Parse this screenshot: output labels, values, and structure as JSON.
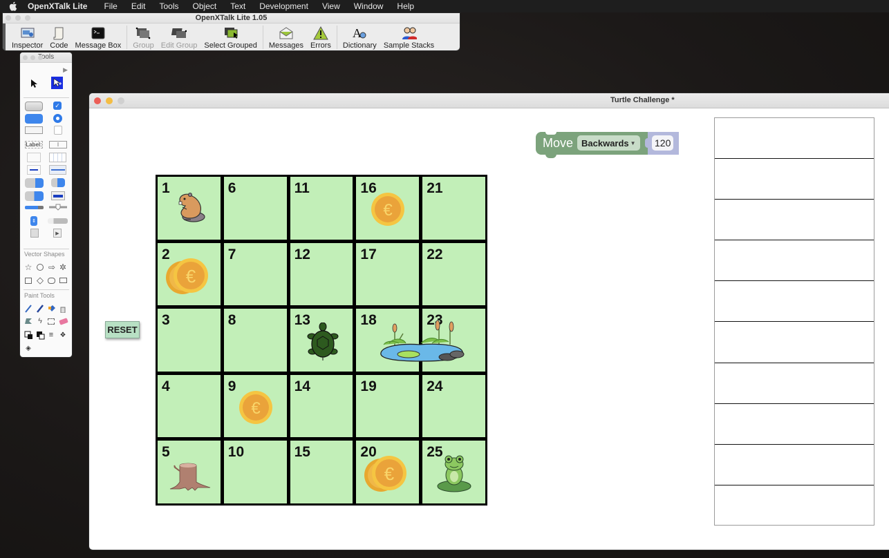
{
  "menubar": {
    "app_name": "OpenXTalk Lite",
    "items": [
      "File",
      "Edit",
      "Tools",
      "Object",
      "Text",
      "Development",
      "View",
      "Window",
      "Help"
    ]
  },
  "toolbar_window": {
    "title": "OpenXTalk Lite 1.05",
    "buttons": [
      {
        "label": "Inspector",
        "icon": "inspector-icon",
        "enabled": true
      },
      {
        "label": "Code",
        "icon": "script-scroll-icon",
        "enabled": true
      },
      {
        "label": "Message Box",
        "icon": "terminal-icon",
        "enabled": true
      },
      {
        "label": "Group",
        "icon": "group-icon",
        "enabled": false
      },
      {
        "label": "Edit Group",
        "icon": "edit-group-icon",
        "enabled": false
      },
      {
        "label": "Select Grouped",
        "icon": "select-grouped-icon",
        "enabled": true
      },
      {
        "label": "Messages",
        "icon": "envelope-icon",
        "enabled": true
      },
      {
        "label": "Errors",
        "icon": "warning-icon",
        "enabled": true
      },
      {
        "label": "Dictionary",
        "icon": "dictionary-icon",
        "enabled": true
      },
      {
        "label": "Sample Stacks",
        "icon": "people-icon",
        "enabled": true
      }
    ]
  },
  "tools_palette": {
    "title": "Tools",
    "field_label_text": "Label:",
    "sections": {
      "vector": "Vector Shapes",
      "paint": "Paint Tools"
    }
  },
  "stack_window": {
    "title": "Turtle Challenge *",
    "block": {
      "command": "Move",
      "direction": "Backwards",
      "value": "120"
    },
    "reset_label": "RESET",
    "colors": {
      "cell": "#c2efb8",
      "block": "#7ca37c",
      "value_slot": "#b3b8dc",
      "reset": "#b8e0c4"
    },
    "grid": [
      {
        "num": "1",
        "item": "beaver"
      },
      {
        "num": "6",
        "item": ""
      },
      {
        "num": "11",
        "item": ""
      },
      {
        "num": "16",
        "item": "coin"
      },
      {
        "num": "21",
        "item": ""
      },
      {
        "num": "2",
        "item": "coins"
      },
      {
        "num": "7",
        "item": ""
      },
      {
        "num": "12",
        "item": ""
      },
      {
        "num": "17",
        "item": ""
      },
      {
        "num": "22",
        "item": ""
      },
      {
        "num": "3",
        "item": ""
      },
      {
        "num": "8",
        "item": ""
      },
      {
        "num": "13",
        "item": "turtle"
      },
      {
        "num": "18",
        "item": "pond"
      },
      {
        "num": "23",
        "item": ""
      },
      {
        "num": "4",
        "item": ""
      },
      {
        "num": "9",
        "item": "coin"
      },
      {
        "num": "14",
        "item": ""
      },
      {
        "num": "19",
        "item": ""
      },
      {
        "num": "24",
        "item": ""
      },
      {
        "num": "5",
        "item": "stump"
      },
      {
        "num": "10",
        "item": ""
      },
      {
        "num": "15",
        "item": ""
      },
      {
        "num": "20",
        "item": "coins"
      },
      {
        "num": "25",
        "item": "frog"
      }
    ],
    "list_rows": [
      "",
      "",
      "",
      "",
      "",
      "",
      "",
      "",
      "",
      ""
    ]
  }
}
